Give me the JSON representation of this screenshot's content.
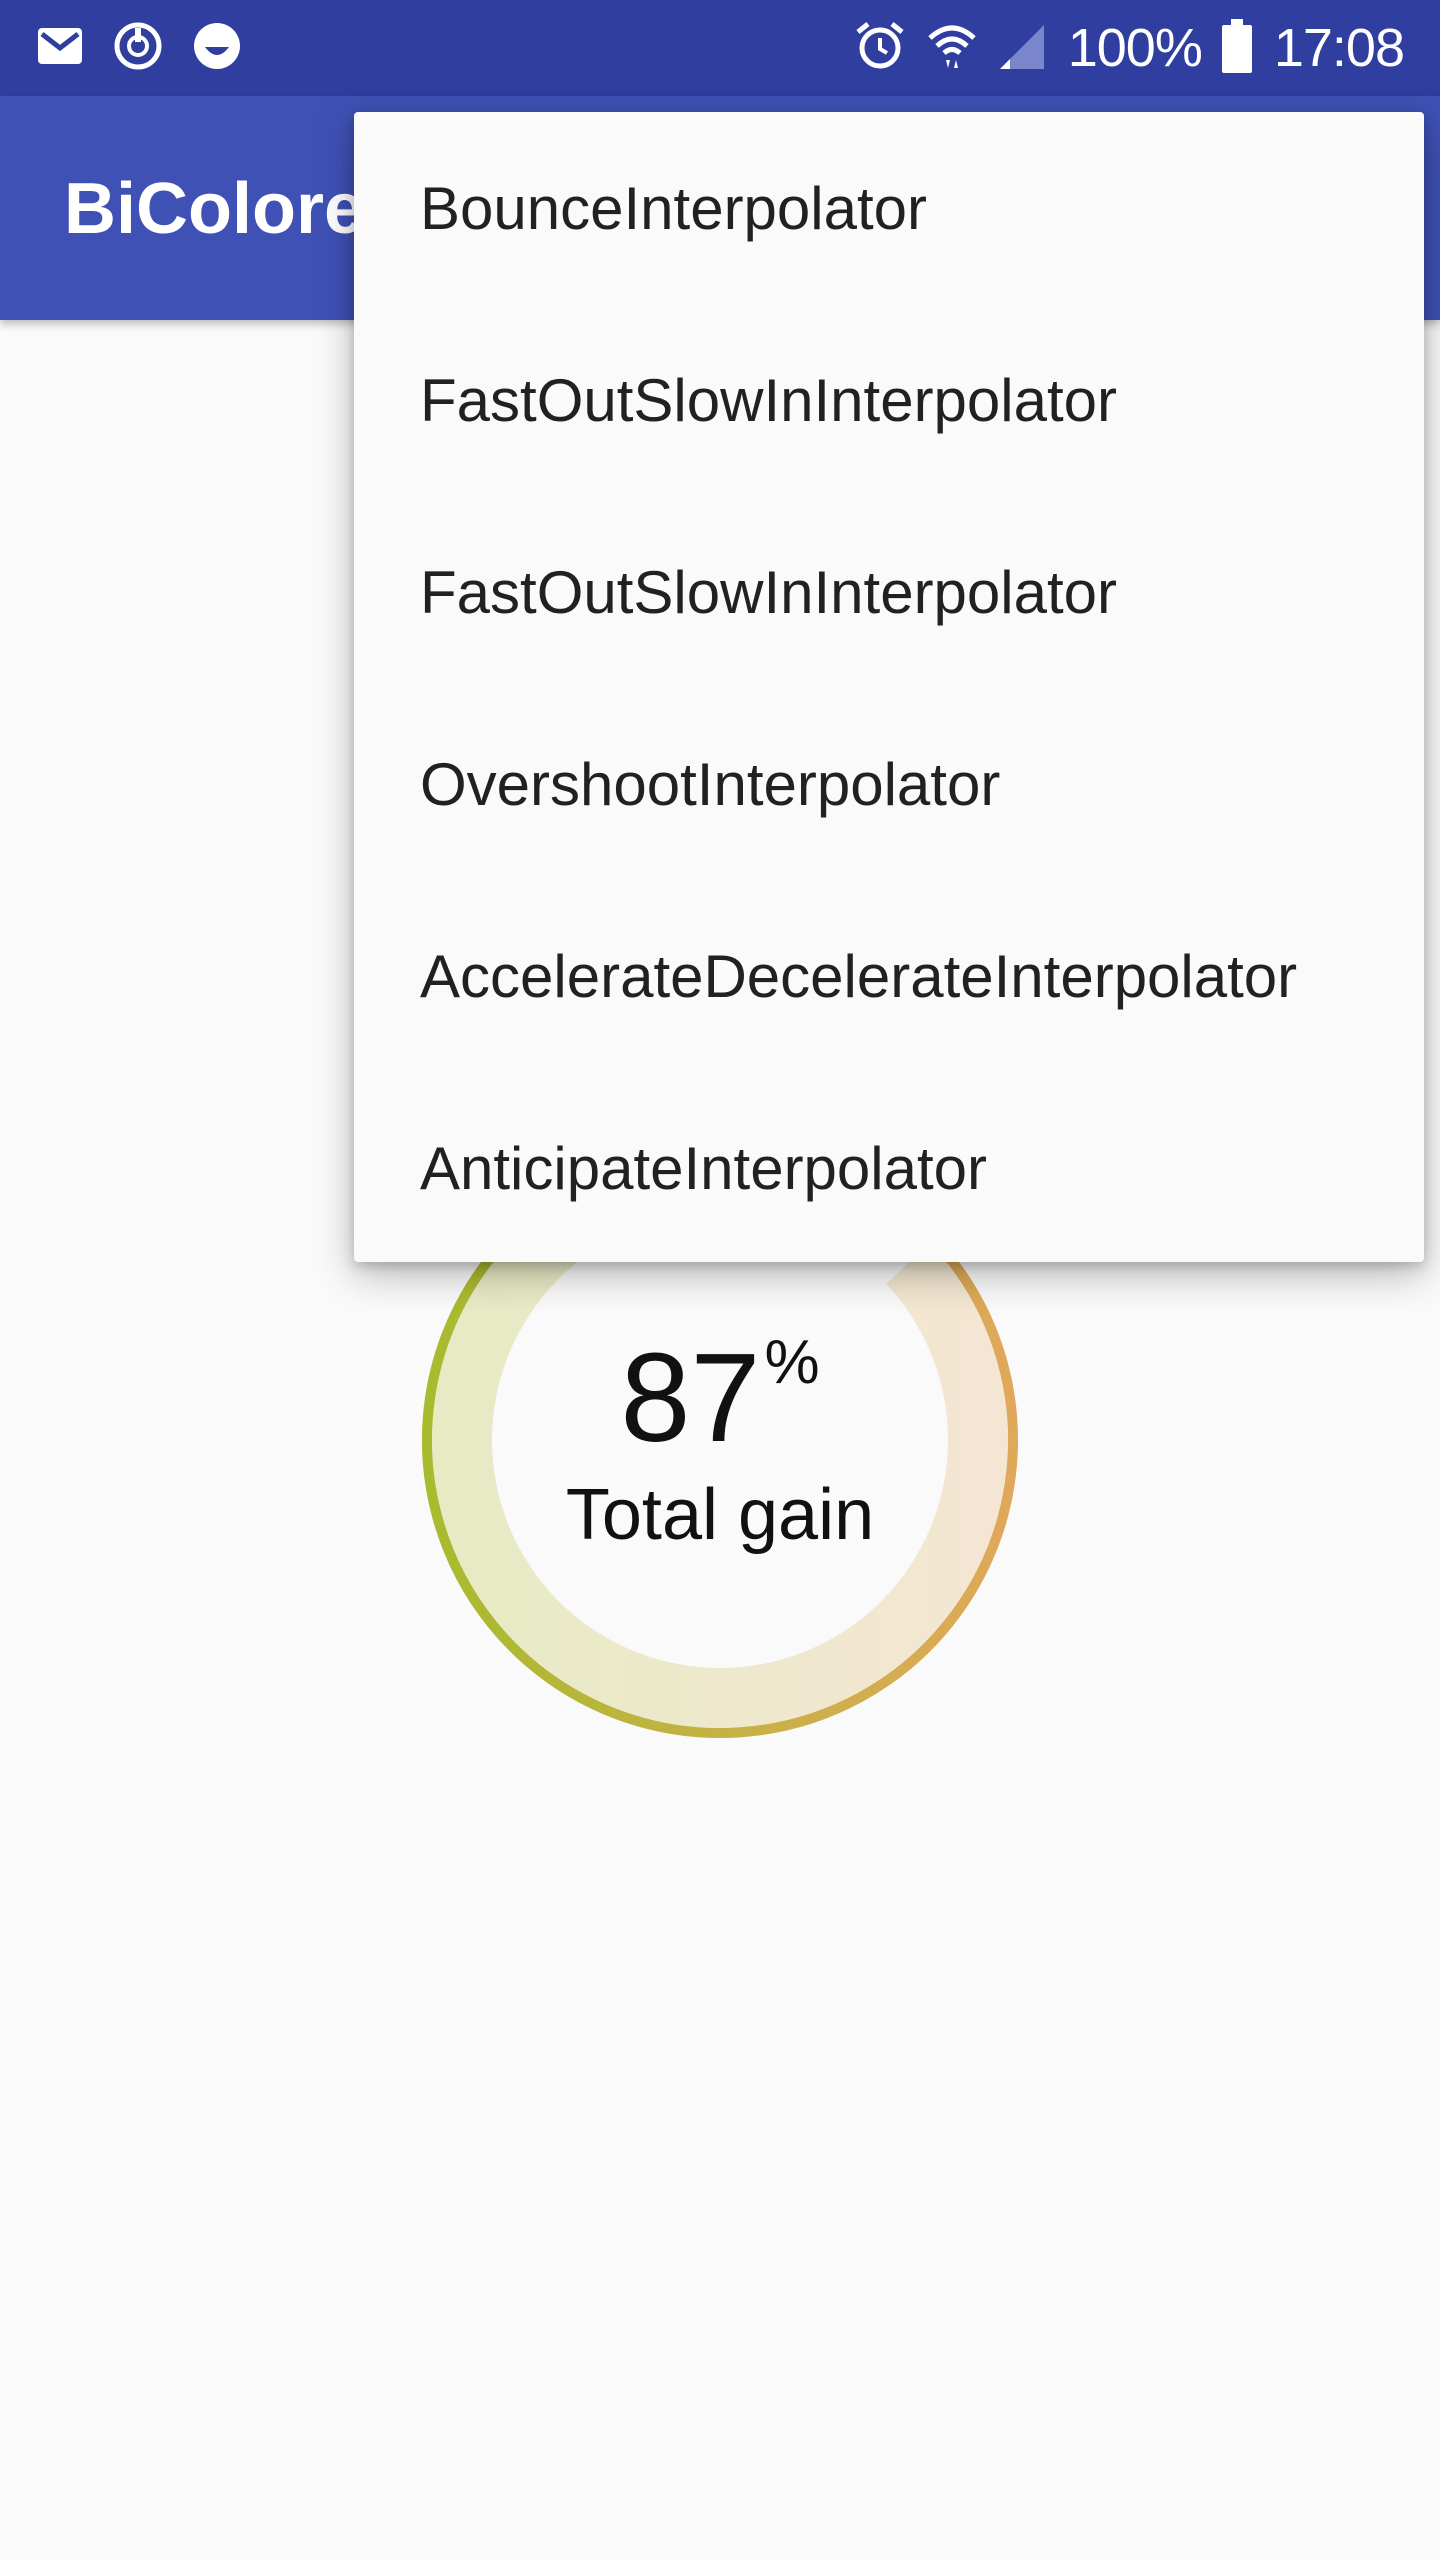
{
  "status_bar": {
    "battery_text": "100%",
    "time": "17:08",
    "icons_left": [
      "mail-icon",
      "sync-icon",
      "smiley-icon"
    ],
    "icons_right": [
      "alarm-icon",
      "wifi-icon",
      "signal-icon",
      "battery-icon"
    ]
  },
  "app_bar": {
    "title": "BiColoredProgress"
  },
  "gauge": {
    "value": "87",
    "unit": "%",
    "label": "Total gain",
    "progress": 0.87,
    "colors": {
      "start": "#a8bb2e",
      "end": "#e0a85a",
      "fill_start": "#e6ebc4",
      "fill_end": "#f5e6d3"
    }
  },
  "menu": {
    "items": [
      {
        "label": "BounceInterpolator"
      },
      {
        "label": "FastOutSlowInInterpolator"
      },
      {
        "label": "FastOutSlowInInterpolator"
      },
      {
        "label": "OvershootInterpolator"
      },
      {
        "label": "AccelerateDecelerateInterpolator"
      },
      {
        "label": "AnticipateInterpolator"
      }
    ]
  },
  "colors": {
    "primary_dark": "#303f9f",
    "primary": "#3f51b5",
    "background": "#fafafa"
  }
}
